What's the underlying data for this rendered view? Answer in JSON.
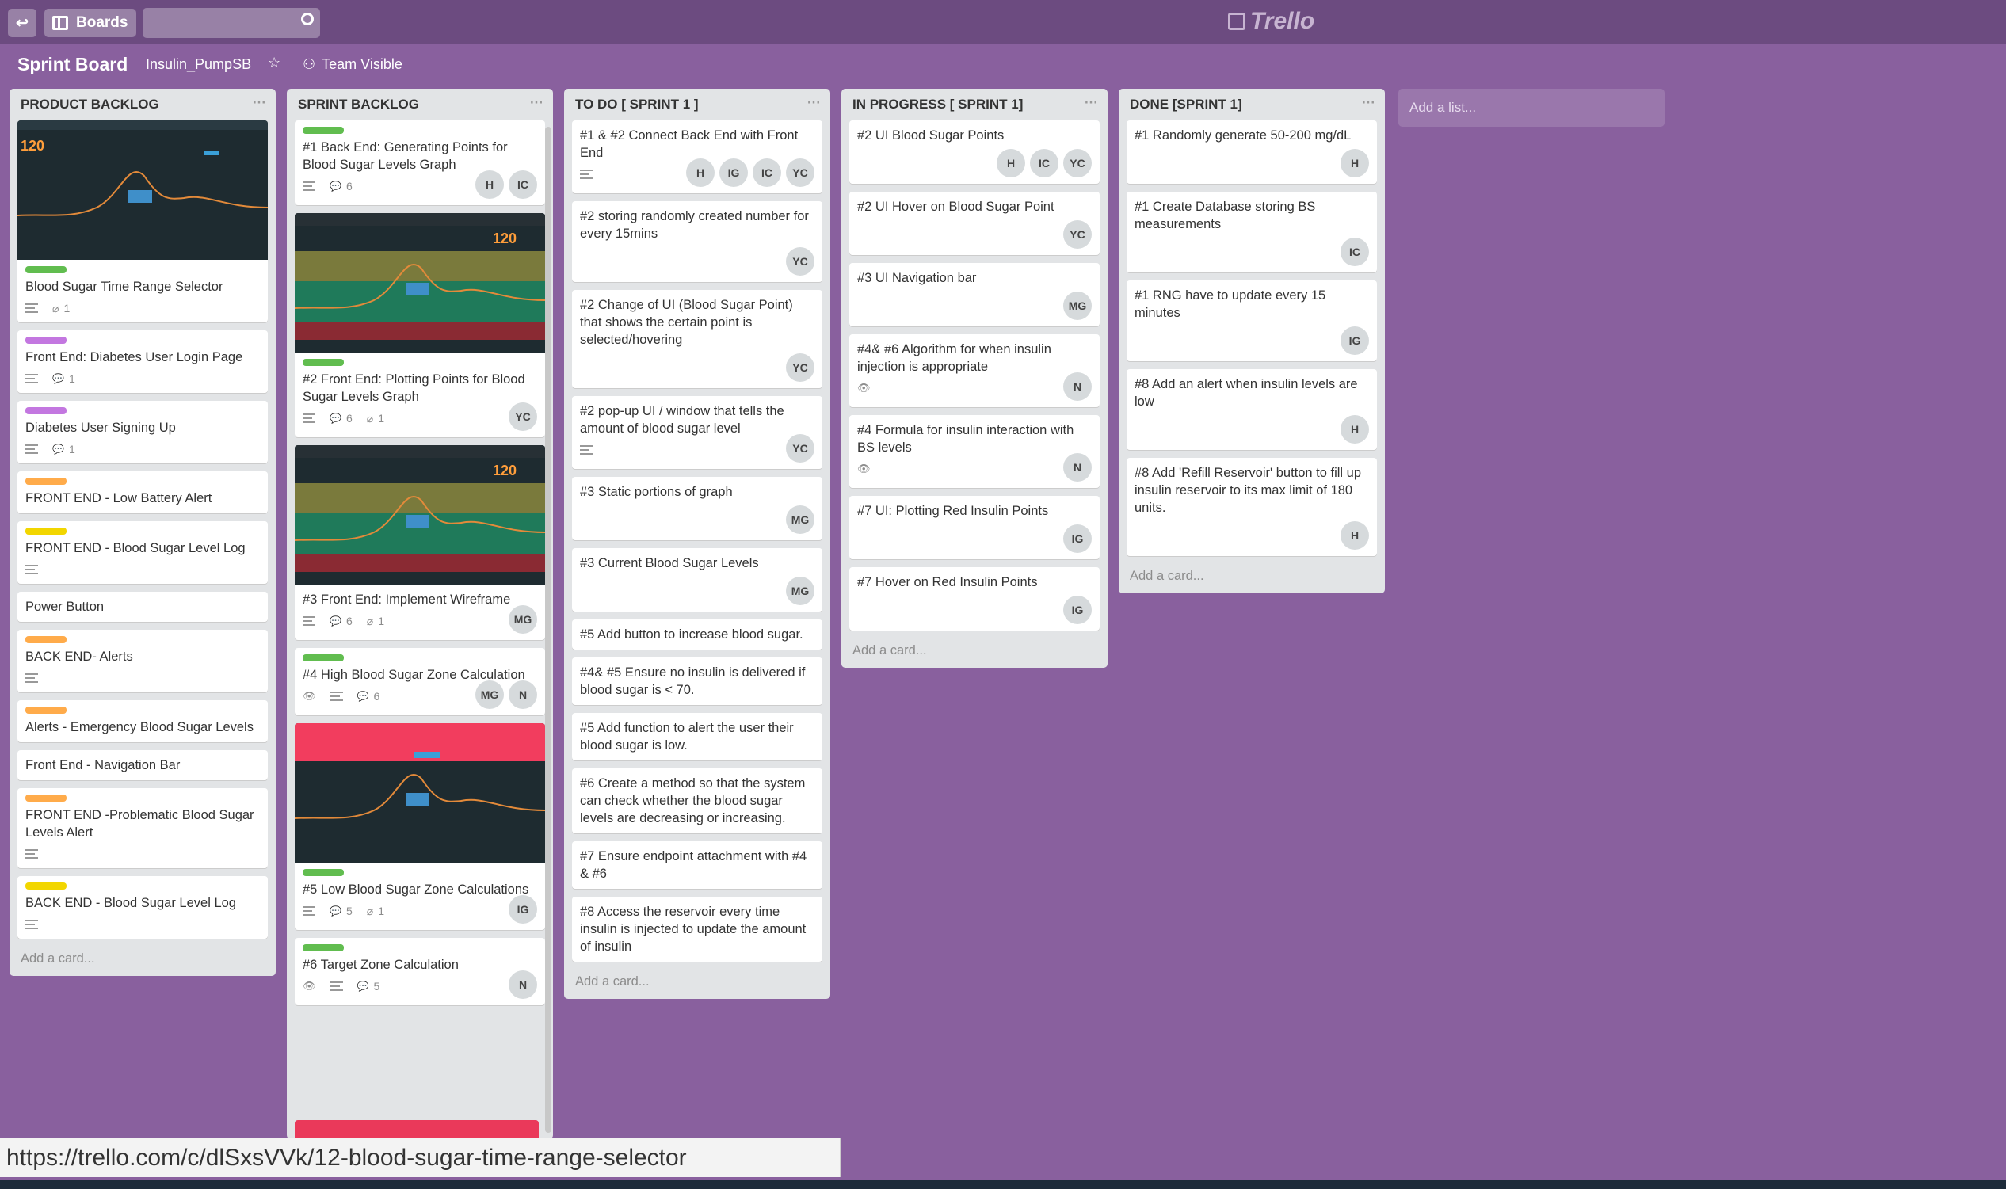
{
  "topbar": {
    "boards_label": "Boards",
    "logo": "Trello"
  },
  "board": {
    "title": "Sprint Board",
    "org": "Insulin_PumpSB",
    "visibility": "Team Visible"
  },
  "lists": [
    {
      "title": "PRODUCT BACKLOG",
      "dots": "···",
      "add": "Add a card...",
      "cards": [
        {
          "cover": "chart",
          "label": "#61bd4f",
          "title": "Blood Sugar Time Range Selector",
          "desc": true,
          "attach": "1"
        },
        {
          "label": "#c377e0",
          "title": "Front End: Diabetes User Login Page",
          "desc": true,
          "comments": "1"
        },
        {
          "label": "#c377e0",
          "title": "Diabetes User Signing Up",
          "desc": true,
          "comments": "1"
        },
        {
          "label": "#ffab4a",
          "title": "FRONT END - Low Battery Alert"
        },
        {
          "label": "#f2d600",
          "title": "FRONT END - Blood Sugar Level Log",
          "desc": true
        },
        {
          "title": "Power Button"
        },
        {
          "label": "#ffab4a",
          "title": "BACK END- Alerts",
          "desc": true
        },
        {
          "label": "#ffab4a",
          "title": "Alerts - Emergency Blood Sugar Levels"
        },
        {
          "title": "Front End - Navigation Bar"
        },
        {
          "label": "#ffab4a",
          "title": "FRONT END -Problematic Blood Sugar Levels Alert",
          "desc": true
        },
        {
          "label": "#f2d600",
          "title": "BACK END - Blood Sugar Level Log",
          "desc": true
        }
      ]
    },
    {
      "title": "SPRINT BACKLOG",
      "dots": "···",
      "add": "",
      "cards": [
        {
          "label": "#61bd4f",
          "title": "#1 Back End: Generating Points for Blood Sugar Levels Graph",
          "desc": true,
          "comments": "6",
          "members": [
            "H",
            "IC"
          ]
        },
        {
          "cover": "zones",
          "label": "#61bd4f",
          "title": "#2 Front End: Plotting Points for Blood Sugar Levels Graph",
          "desc": true,
          "comments": "6",
          "attach": "1",
          "members": [
            "YC"
          ]
        },
        {
          "cover": "zones",
          "title": "#3 Front End: Implement Wireframe",
          "desc": true,
          "comments": "6",
          "attach": "1",
          "members": [
            "MG"
          ]
        },
        {
          "label": "#61bd4f",
          "title": "#4 High Blood Sugar Zone Calculation",
          "watch": true,
          "desc": true,
          "comments": "6",
          "members": [
            "MG",
            "N"
          ]
        },
        {
          "cover": "alert",
          "label": "#61bd4f",
          "title": "#5 Low Blood Sugar Zone Calculations",
          "desc": true,
          "comments": "5",
          "attach": "1",
          "members": [
            "IG"
          ]
        },
        {
          "label": "#61bd4f",
          "title": "#6 Target Zone Calculation",
          "watch": true,
          "desc": true,
          "comments": "5",
          "members": [
            "N"
          ]
        }
      ]
    },
    {
      "title": "TO DO [ SPRINT 1 ]",
      "dots": "···",
      "add": "Add a card...",
      "cards": [
        {
          "title": "#1 & #2 Connect Back End with Front End",
          "desc": true,
          "members": [
            "H",
            "IG",
            "IC",
            "YC"
          ]
        },
        {
          "title": "#2 storing randomly created number for every 15mins",
          "members": [
            "YC"
          ]
        },
        {
          "title": "#2 Change of UI (Blood Sugar Point) that shows the certain point is selected/hovering",
          "members": [
            "YC"
          ]
        },
        {
          "title": "#2 pop-up UI / window that tells the amount of blood sugar level",
          "desc": true,
          "members": [
            "YC"
          ]
        },
        {
          "title": "#3 Static portions of graph",
          "members": [
            "MG"
          ]
        },
        {
          "title": "#3 Current Blood Sugar Levels",
          "members": [
            "MG"
          ]
        },
        {
          "title": "#5 Add button to increase blood sugar."
        },
        {
          "title": "#4& #5 Ensure no insulin is delivered if blood sugar is < 70."
        },
        {
          "title": "#5 Add function to alert the user their blood sugar is low."
        },
        {
          "title": "#6 Create a method so that the system can check whether the blood sugar levels are decreasing or increasing."
        },
        {
          "title": "#7 Ensure endpoint attachment with #4 & #6"
        },
        {
          "title": "#8 Access the reservoir every time insulin is injected to update the amount of insulin"
        }
      ]
    },
    {
      "title": "IN PROGRESS [ SPRINT 1]",
      "dots": "···",
      "add": "Add a card...",
      "cards": [
        {
          "title": "#2 UI Blood Sugar Points",
          "members": [
            "H",
            "IC",
            "YC"
          ]
        },
        {
          "title": "#2 UI Hover on Blood Sugar Point",
          "members": [
            "YC"
          ]
        },
        {
          "title": "#3 UI Navigation bar",
          "members": [
            "MG"
          ]
        },
        {
          "title": "#4& #6 Algorithm for when insulin injection is appropriate",
          "watch": true,
          "members": [
            "N"
          ]
        },
        {
          "title": "#4 Formula for insulin interaction with BS levels",
          "watch": true,
          "members": [
            "N"
          ]
        },
        {
          "title": "#7 UI: Plotting Red Insulin Points",
          "members": [
            "IG"
          ]
        },
        {
          "title": "#7 Hover on Red Insulin Points",
          "members": [
            "IG"
          ]
        }
      ]
    },
    {
      "title": "DONE [SPRINT 1]",
      "dots": "···",
      "add": "Add a card...",
      "cards": [
        {
          "title": "#1 Randomly generate 50-200 mg/dL",
          "members": [
            "H"
          ]
        },
        {
          "title": "#1 Create Database storing BS measurements",
          "members": [
            "IC"
          ]
        },
        {
          "title": "#1 RNG have to update every 15 minutes",
          "members": [
            "IG"
          ]
        },
        {
          "title": "#8 Add an alert when insulin levels are low",
          "members": [
            "H"
          ]
        },
        {
          "title": "#8 Add 'Refill Reservoir' button to fill up insulin reservoir to its max limit of 180 units.",
          "members": [
            "H"
          ]
        }
      ]
    }
  ],
  "add_list": "Add a list...",
  "status_url": "https://trello.com/c/dlSxsVVk/12-blood-sugar-time-range-selector"
}
